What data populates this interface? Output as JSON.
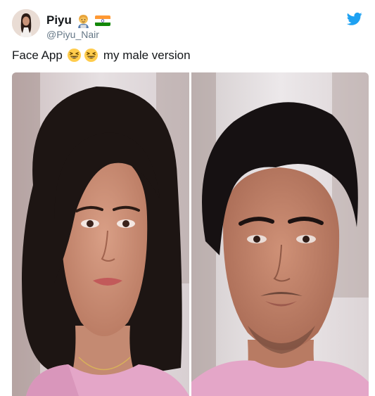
{
  "tweet": {
    "display_name": "Piyu",
    "handle": "@Piyu_Nair",
    "text_before": "Face App",
    "text_after": "my male version",
    "emojis": [
      "laughing-emoji",
      "laughing-emoji"
    ],
    "badges": [
      "woman-technologist-emoji",
      "india-flag"
    ]
  },
  "icons": {
    "brand": "twitter-bird-icon"
  },
  "colors": {
    "twitter_blue": "#1da1f2",
    "text": "#14171a",
    "secondary_text": "#657786"
  },
  "media": {
    "images": [
      "female-face-photo",
      "male-face-photo"
    ]
  }
}
